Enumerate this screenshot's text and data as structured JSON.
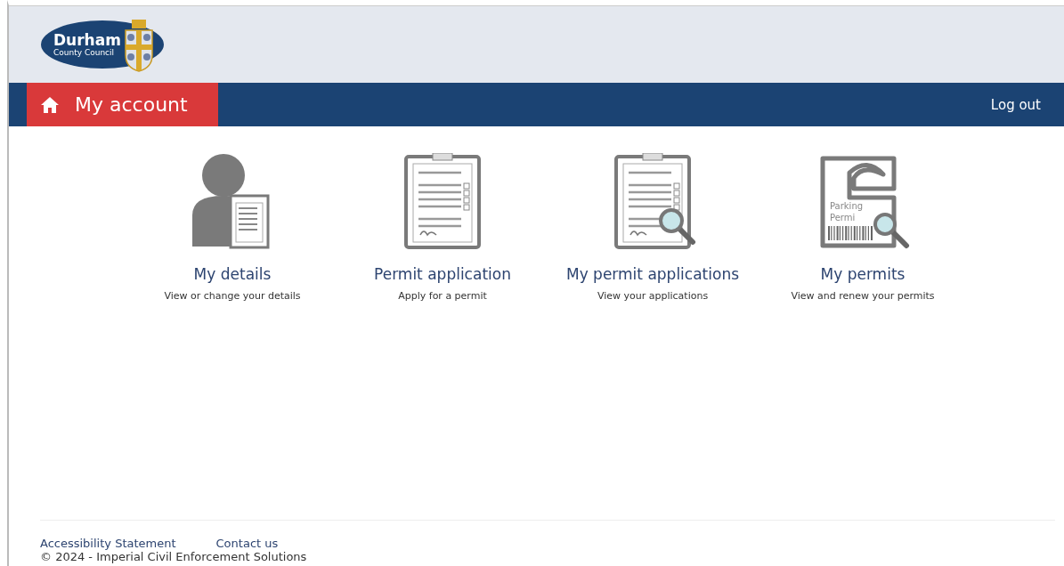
{
  "logo": {
    "name": "Durham",
    "subtitle": "County Council"
  },
  "nav": {
    "title": "My account",
    "logout": "Log out"
  },
  "tiles": [
    {
      "kind": "person",
      "title": "My details",
      "description": "View or change your details"
    },
    {
      "kind": "clipboard",
      "title": "Permit application",
      "description": "Apply for a permit"
    },
    {
      "kind": "clipboard-search",
      "title": "My permit applications",
      "description": "View your applications"
    },
    {
      "kind": "parking",
      "title": "My permits",
      "description": "View and renew your permits",
      "icon_text": [
        "Parking",
        "Permi"
      ]
    }
  ],
  "footer": {
    "links": [
      "Accessibility Statement",
      "Contact us"
    ],
    "copyright": "© 2024 - Imperial Civil Enforcement Solutions"
  }
}
